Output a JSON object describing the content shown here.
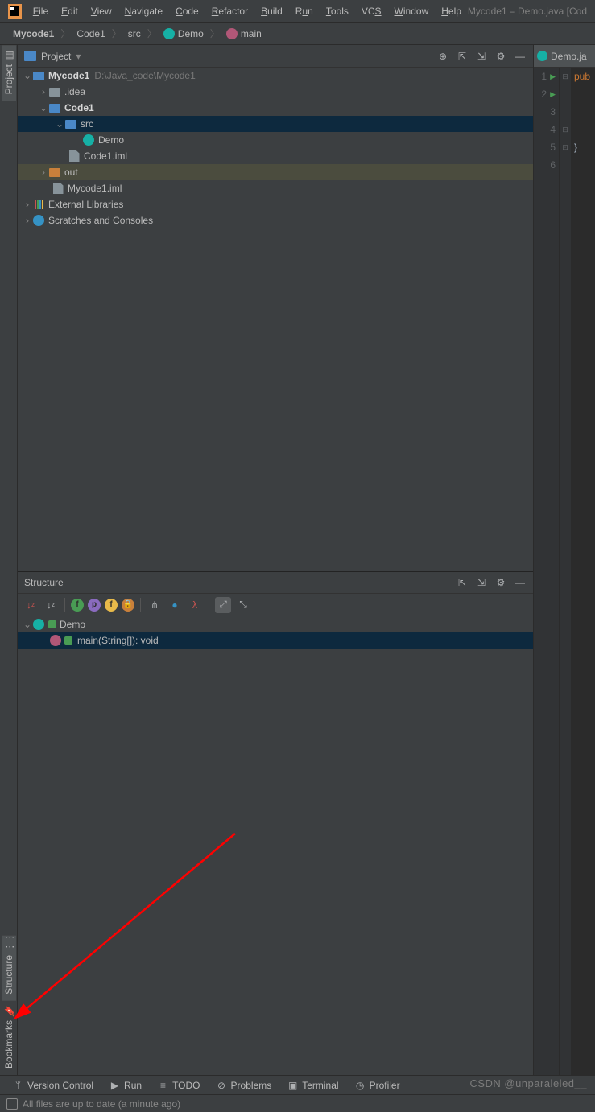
{
  "menu": {
    "items": [
      "File",
      "Edit",
      "View",
      "Navigate",
      "Code",
      "Refactor",
      "Build",
      "Run",
      "Tools",
      "VCS",
      "Window",
      "Help"
    ],
    "underlines": [
      "F",
      "E",
      "V",
      "N",
      "C",
      "R",
      "B",
      "u",
      "T",
      "S",
      "W",
      "H"
    ],
    "title": "Mycode1 – Demo.java [Cod"
  },
  "breadcrumb": {
    "items": [
      "Mycode1",
      "Code1",
      "src",
      "Demo",
      "main"
    ]
  },
  "left_strip": {
    "project": "Project",
    "structure": "Structure",
    "bookmarks": "Bookmarks"
  },
  "project_panel": {
    "title": "Project",
    "tree": {
      "root": "Mycode1",
      "root_path": "D:\\Java_code\\Mycode1",
      "idea": ".idea",
      "code1": "Code1",
      "src": "src",
      "demo": "Demo",
      "code1_iml": "Code1.iml",
      "out": "out",
      "mycode1_iml": "Mycode1.iml",
      "ext_libs": "External Libraries",
      "scratches": "Scratches and Consoles"
    }
  },
  "structure_panel": {
    "title": "Structure",
    "class": "Demo",
    "method": "main(String[]): void"
  },
  "editor": {
    "tab": "Demo.ja",
    "lines": [
      "1",
      "2",
      "3",
      "4",
      "5",
      "6"
    ],
    "code_kw": "pub",
    "brace": "}"
  },
  "bottom": {
    "vcs": "Version Control",
    "run": "Run",
    "todo": "TODO",
    "problems": "Problems",
    "terminal": "Terminal",
    "profiler": "Profiler"
  },
  "status": {
    "text": "All files are up to date (a minute ago)"
  },
  "watermark": "CSDN @unparaleled__"
}
